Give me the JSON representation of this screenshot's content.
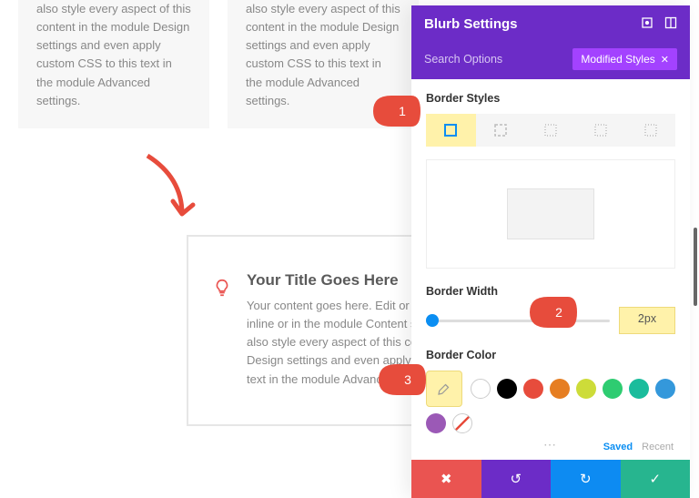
{
  "bg_cards": {
    "text": "also style every aspect of this content in the module Design settings and even apply custom CSS to this text in the module Advanced settings."
  },
  "preview": {
    "title": "Your Title Goes Here",
    "body": "Your content goes here. Edit or remove this text inline or in the module Content settings. You can also style every aspect of this content in the module Design settings and even apply custom CSS to this text in the module Advanced settings."
  },
  "panel": {
    "title": "Blurb Settings",
    "search_label": "Search Options",
    "modified_label": "Modified Styles",
    "modified_close": "✕",
    "section_border_styles": "Border Styles",
    "section_border_width": "Border Width",
    "border_width_value": "2px",
    "section_border_color": "Border Color",
    "saved_label": "Saved",
    "recent_label": "Recent",
    "colors": [
      "#ffffff",
      "#000000",
      "#e74c3c",
      "#e67e22",
      "#f1c40f",
      "#2ecc71",
      "#1abc9c",
      "#3498db",
      "#9b59b6"
    ]
  },
  "callouts": {
    "c1": "1",
    "c2": "2",
    "c3": "3"
  },
  "footer": {
    "cancel": "✖",
    "undo": "↺",
    "redo": "↻",
    "confirm": "✓"
  }
}
